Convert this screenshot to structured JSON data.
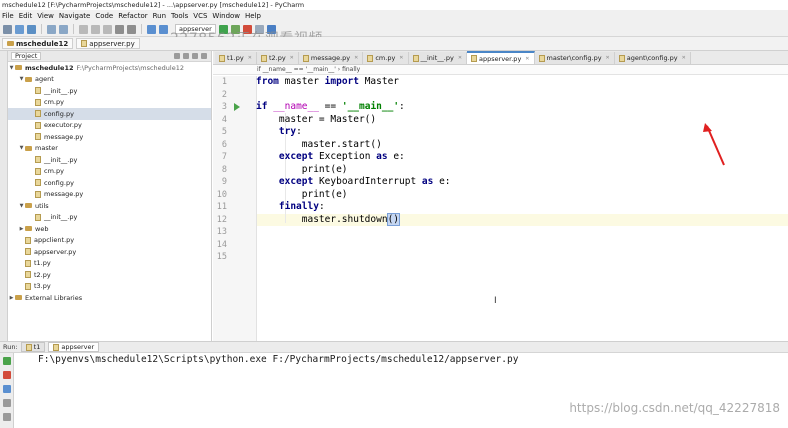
{
  "window": {
    "title": "mschedule12 [F:\\PycharmProjects\\mschedule12] - ...\\appserver.py [mschedule12] - PyCharm"
  },
  "menu": [
    "File",
    "Edit",
    "View",
    "Navigate",
    "Code",
    "Refactor",
    "Run",
    "Tools",
    "VCS",
    "Window",
    "Help"
  ],
  "toolbar": {
    "run_config": "appserver"
  },
  "overlay_text": "2278562正在观看视频",
  "navbar": {
    "project": "mschedule12",
    "file": "appserver.py"
  },
  "project_panel": {
    "label": "Project",
    "root_name": "mschedule12",
    "root_path": "F:\\PycharmProjects\\mschedule12",
    "items": [
      {
        "name": "agent",
        "type": "folder",
        "depth": 1,
        "expanded": true
      },
      {
        "name": "__init__.py",
        "type": "file",
        "depth": 2
      },
      {
        "name": "cm.py",
        "type": "file",
        "depth": 2
      },
      {
        "name": "config.py",
        "type": "file",
        "depth": 2,
        "selected": true
      },
      {
        "name": "executor.py",
        "type": "file",
        "depth": 2
      },
      {
        "name": "message.py",
        "type": "file",
        "depth": 2
      },
      {
        "name": "master",
        "type": "folder",
        "depth": 1,
        "expanded": true
      },
      {
        "name": "__init__.py",
        "type": "file",
        "depth": 2
      },
      {
        "name": "cm.py",
        "type": "file",
        "depth": 2
      },
      {
        "name": "config.py",
        "type": "file",
        "depth": 2
      },
      {
        "name": "message.py",
        "type": "file",
        "depth": 2
      },
      {
        "name": "utils",
        "type": "folder",
        "depth": 1,
        "expanded": true
      },
      {
        "name": "__init__.py",
        "type": "file",
        "depth": 2
      },
      {
        "name": "web",
        "type": "folder",
        "depth": 1,
        "expanded": false
      },
      {
        "name": "appclient.py",
        "type": "file",
        "depth": 1
      },
      {
        "name": "appserver.py",
        "type": "file",
        "depth": 1
      },
      {
        "name": "t1.py",
        "type": "file",
        "depth": 1
      },
      {
        "name": "t2.py",
        "type": "file",
        "depth": 1
      },
      {
        "name": "t3.py",
        "type": "file",
        "depth": 1
      },
      {
        "name": "External Libraries",
        "type": "library",
        "depth": 0
      }
    ]
  },
  "editor": {
    "tabs": [
      {
        "label": "t1.py",
        "active": false
      },
      {
        "label": "t2.py",
        "active": false
      },
      {
        "label": "message.py",
        "active": false
      },
      {
        "label": "cm.py",
        "active": false
      },
      {
        "label": "__init__.py",
        "active": false
      },
      {
        "label": "appserver.py",
        "active": true
      },
      {
        "label": "master\\config.py",
        "active": false
      },
      {
        "label": "agent\\config.py",
        "active": false
      }
    ],
    "breadcrumb": "if __name__ == '__main__'  ›  finally",
    "line_numbers": [
      "1",
      "2",
      "3",
      "4",
      "5",
      "6",
      "7",
      "8",
      "9",
      "10",
      "11",
      "12",
      "13",
      "14",
      "15"
    ],
    "current_line": "12"
  },
  "run_panel": {
    "label": "Run:",
    "tabs": [
      "t1",
      "appserver"
    ],
    "console_command": "F:\\pyenvs\\mschedule12\\Scripts\\python.exe F:/PycharmProjects/mschedule12/appserver.py"
  },
  "watermark": "https://blog.csdn.net/qq_42227818",
  "colors": {
    "keyword": "#000080",
    "string": "#008000",
    "dunder": "#b200b2",
    "annotation_arrow": "#e02020",
    "active_tab_border": "#4a86c7"
  }
}
